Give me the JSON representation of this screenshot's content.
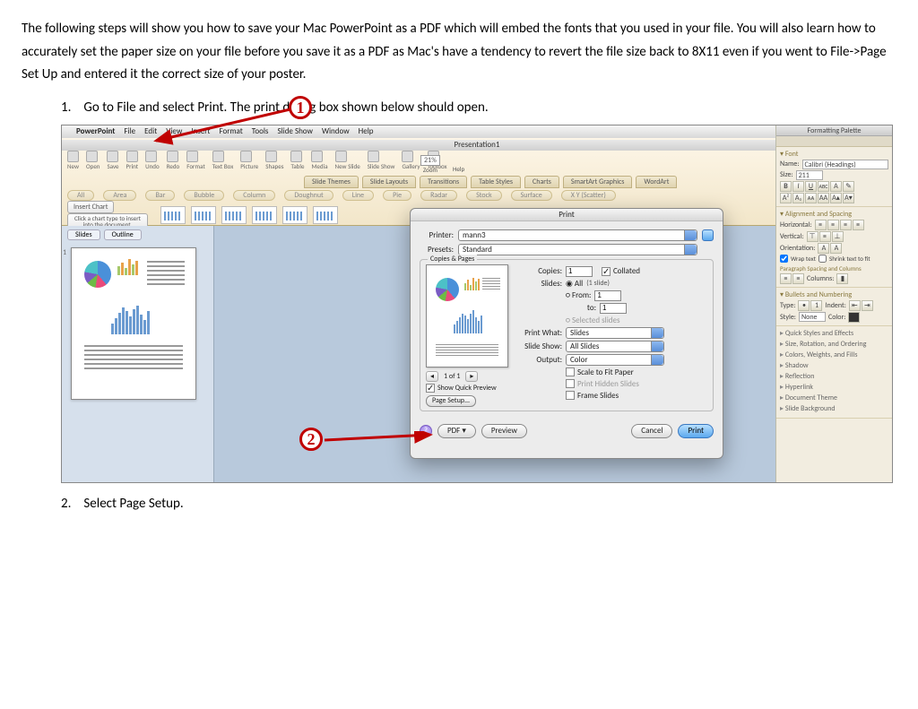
{
  "intro": "The following steps will show you how to save your Mac PowerPoint as a PDF which will embed the fonts that you used in your file.  You will also learn how to accurately set the paper size on your file before you save it as a PDF as Mac's have a tendency to revert the file size back to 8X11 even if you went to File->Page Set Up and entered it the correct size of your poster.",
  "step1_num": "1.",
  "step1_text": "Go to File and select Print.  The print dialog box shown below should open.",
  "step2_num": "2.",
  "step2_text": "Select Page Setup.",
  "anno1": "1",
  "anno2": "2",
  "menubar": {
    "app": "PowerPoint",
    "items": [
      "File",
      "Edit",
      "View",
      "Insert",
      "Format",
      "Tools",
      "Slide Show",
      "Window",
      "Help"
    ]
  },
  "docname": "Presentation1",
  "qat": {
    "items": [
      "New",
      "Open",
      "Save",
      "Print",
      "Undo",
      "Redo",
      "Format",
      "Text Box",
      "Picture",
      "Shapes",
      "Table",
      "Media",
      "New Slide",
      "Slide Show",
      "Gallery",
      "Toolbox"
    ],
    "zoom_lbl": "Zoom",
    "zoom_val": "21%",
    "help": "Help"
  },
  "ribbon_tabs": [
    "Slide Themes",
    "Slide Layouts",
    "Transitions",
    "Table Styles",
    "Charts",
    "SmartArt Graphics",
    "WordArt"
  ],
  "chart_cats": [
    "All",
    "Area",
    "Bar",
    "Bubble",
    "Column",
    "Doughnut",
    "Line",
    "Pie",
    "Radar",
    "Stock",
    "Surface",
    "X Y (Scatter)"
  ],
  "insert_chart": "Insert Chart",
  "chart_hint": "Click a chart type to insert into the document.",
  "view_tabs": [
    "Slides",
    "Outline"
  ],
  "palette": {
    "title": "Formatting Palette",
    "font_hdr": "Font",
    "name_lbl": "Name:",
    "name_val": "Calibri (Headings)",
    "size_lbl": "Size:",
    "size_val": "211",
    "bold": "B",
    "italic": "I",
    "under": "U",
    "strike": "ABC",
    "sup": "A²",
    "sub": "A₂",
    "smcap": "ᴀᴀ",
    "allcap": "AA",
    "grow": "A▴",
    "shrink": "A▾",
    "align_hdr": "Alignment and Spacing",
    "horiz": "Horizontal:",
    "vert": "Vertical:",
    "orient": "Orientation:",
    "wrap": "Wrap text",
    "shrinkfit": "Shrink text to fit",
    "para_hdr": "Paragraph Spacing and Columns",
    "cols": "Columns:",
    "bul_hdr": "Bullets and Numbering",
    "type": "Type:",
    "indent": "Indent:",
    "style": "Style:",
    "style_val": "None",
    "color": "Color:",
    "disc": [
      "Quick Styles and Effects",
      "Size, Rotation, and Ordering",
      "Colors, Weights, and Fills",
      "Shadow",
      "Reflection",
      "Hyperlink",
      "Document Theme",
      "Slide Background"
    ]
  },
  "print": {
    "title": "Print",
    "printer_lbl": "Printer:",
    "printer_val": "mann3",
    "presets_lbl": "Presets:",
    "presets_val": "Standard",
    "group": "Copies & Pages",
    "copies_lbl": "Copies:",
    "copies_val": "1",
    "collated": "Collated",
    "slides_lbl": "Slides:",
    "all": "All",
    "all_suffix": "(1 slide)",
    "from_lbl": "From:",
    "from_val": "1",
    "to_lbl": "to:",
    "to_val": "1",
    "sel": "Selected slides",
    "pw_lbl": "Print What:",
    "pw_val": "Slides",
    "ss_lbl": "Slide Show:",
    "ss_val": "All Slides",
    "out_lbl": "Output:",
    "out_val": "Color",
    "scale": "Scale to Fit Paper",
    "hidden": "Print Hidden Slides",
    "frame": "Frame Slides",
    "nav_page": "1 of 1",
    "quick": "Show Quick Preview",
    "page_setup": "Page Setup...",
    "help": "?",
    "pdf": "PDF ▾",
    "preview": "Preview",
    "cancel": "Cancel",
    "print_btn": "Print"
  }
}
